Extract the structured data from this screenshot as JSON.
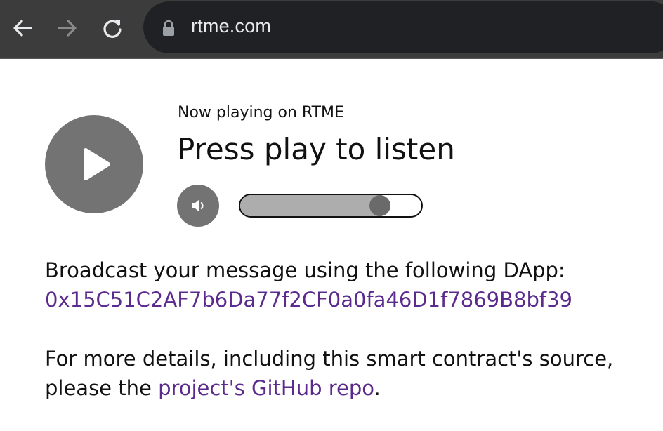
{
  "browser": {
    "url": "rtme.com",
    "icons": {
      "back": "arrow-left-icon",
      "forward": "arrow-right-icon",
      "reload": "reload-icon",
      "lock": "lock-icon"
    }
  },
  "player": {
    "now_playing_label": "Now playing on RTME",
    "title": "Press play to listen",
    "volume_level": 0.77,
    "icons": {
      "play": "play-icon",
      "volume": "speaker-icon"
    }
  },
  "content": {
    "broadcast_text": "Broadcast your message using the following DApp:",
    "contract_address": "0x15C51C2AF7b6Da77f2CF0a0fa46D1f7869B8bf39",
    "details_line1": "For more details, including this smart contract's source,",
    "details_prefix": "please the ",
    "repo_link_text": "project's GitHub repo",
    "details_suffix": "."
  },
  "colors": {
    "chrome_bg": "#3c3c3c",
    "omnibox_bg": "#202124",
    "player_gray": "#737373",
    "link_purple": "#5b2a8c"
  }
}
